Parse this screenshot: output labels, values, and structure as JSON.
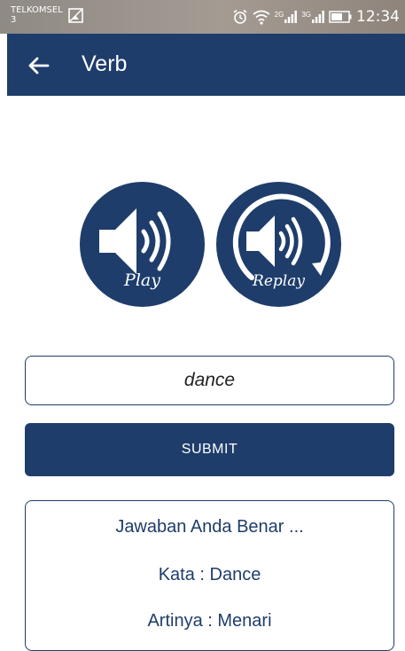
{
  "status_bar": {
    "carrier": "TELKOMSEL",
    "carrier_sub": "3",
    "network_1": "2G",
    "network_2": "3G",
    "time": "12:34"
  },
  "app_bar": {
    "title": "Verb"
  },
  "audio": {
    "play_label": "Play",
    "replay_label": "Replay"
  },
  "answer": {
    "value": "dance"
  },
  "submit": {
    "label": "SUBMIT"
  },
  "result": {
    "status": "Jawaban Anda Benar ...",
    "word": "Kata : Dance",
    "meaning": "Artinya : Menari"
  },
  "colors": {
    "primary": "#1e3d6b",
    "status_bar": "#9a918a",
    "background": "#ffffff"
  }
}
